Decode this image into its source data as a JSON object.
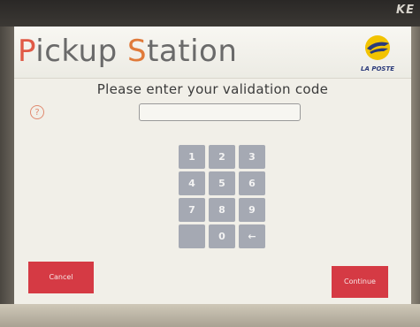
{
  "device": {
    "brand_tag": "KE"
  },
  "header": {
    "title_part1_p": "P",
    "title_part1_rest": "ickup ",
    "title_part2_s": "S",
    "title_part2_rest": "tation",
    "logo_text": "LA POSTE",
    "logo_icon": "la-poste-bird-logo"
  },
  "prompt": {
    "text": "Please enter your validation code"
  },
  "help": {
    "icon": "help-icon",
    "glyph": "?"
  },
  "code_input": {
    "value": "",
    "placeholder": ""
  },
  "keypad": {
    "keys": [
      "1",
      "2",
      "3",
      "4",
      "5",
      "6",
      "7",
      "8",
      "9",
      "",
      "0",
      "←"
    ],
    "backspace_icon": "backspace-arrow-icon"
  },
  "actions": {
    "cancel_label": "Cancel",
    "continue_label": "Continue"
  },
  "colors": {
    "accent_red": "#d53a44",
    "title_orange": "#e07a3a",
    "key_gray": "#a5a9b3",
    "logo_yellow": "#f2c300",
    "logo_blue": "#2a3a7a"
  }
}
